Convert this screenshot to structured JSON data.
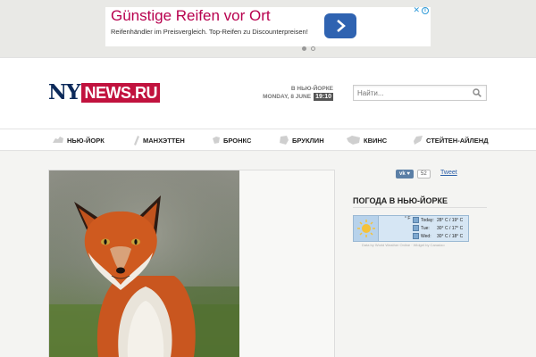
{
  "ad": {
    "title": "Günstige Reifen vor Ort",
    "description": "Reifenhändler im Preisvergleich. Top-Reifen zu Discounterpreisen!",
    "info_icon": "i",
    "close_icon": "✕"
  },
  "header": {
    "logo_ny": "NY",
    "logo_news": "NEWS.RU",
    "city": "В НЬЮ-ЙОРКЕ",
    "date": "MONDAY, 8 JUNE",
    "time": "19:10",
    "search_placeholder": "Найти..."
  },
  "nav": {
    "items": [
      {
        "label": "НЬЮ-ЙОРК",
        "icon": "map-ny-icon"
      },
      {
        "label": "МАНХЭТТЕН",
        "icon": "map-manhattan-icon"
      },
      {
        "label": "БРОНКС",
        "icon": "map-bronx-icon"
      },
      {
        "label": "БРУКЛИН",
        "icon": "map-brooklyn-icon"
      },
      {
        "label": "КВИНС",
        "icon": "map-queens-icon"
      },
      {
        "label": "СТЕЙТЕН-АЙЛЕНД",
        "icon": "map-staten-island-icon"
      }
    ]
  },
  "social": {
    "vk_count": "52",
    "tweet_label": "Tweet"
  },
  "weather": {
    "title": "ПОГОДА В НЬЮ-ЙОРКЕ",
    "units": "° F",
    "rows": [
      {
        "day": "Today:",
        "temp": "28° C / 19° C"
      },
      {
        "day": "Tue:",
        "temp": "30° C / 17° C"
      },
      {
        "day": "Wed:",
        "temp": "30° C / 18° C"
      }
    ],
    "footer": "Data by World Weather Online · Widget by Canadzo"
  }
}
